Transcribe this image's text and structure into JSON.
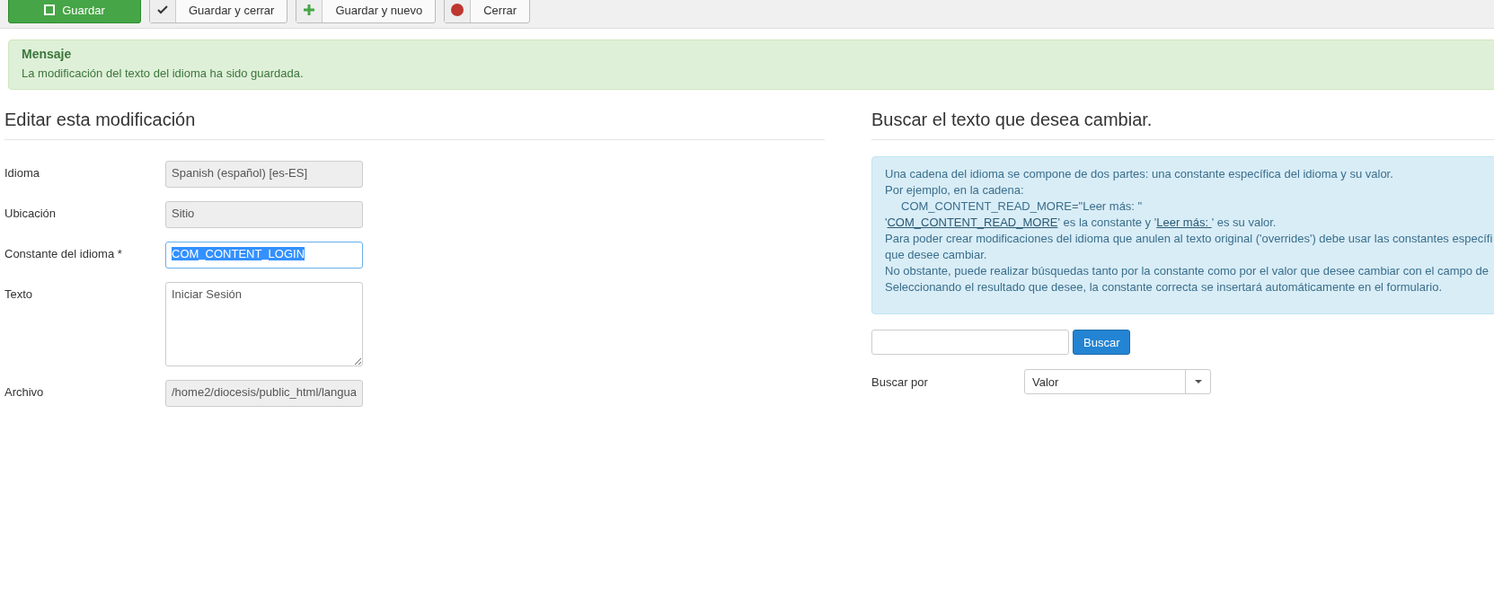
{
  "toolbar": {
    "buttons": [
      {
        "label": "Guardar",
        "kind": "primary"
      },
      {
        "label": "Guardar y cerrar",
        "kind": "default"
      },
      {
        "label": "Guardar y nuevo",
        "kind": "default"
      },
      {
        "label": "Cerrar",
        "kind": "default"
      }
    ]
  },
  "message": {
    "title": "Mensaje",
    "text": "La modificación del texto del idioma ha sido guardada."
  },
  "edit": {
    "heading": "Editar esta modificación",
    "fields": [
      {
        "label": "Idioma",
        "kind": "input",
        "value": "Spanish (español) [es-ES]",
        "readonly": true,
        "focused": false,
        "selected": false
      },
      {
        "label": "Ubicación",
        "kind": "input",
        "value": "Sitio",
        "readonly": true,
        "focused": false,
        "selected": false
      },
      {
        "label": "Constante del idioma *",
        "kind": "input",
        "value": "COM_CONTENT_LOGIN",
        "readonly": false,
        "focused": true,
        "selected": true
      },
      {
        "label": "Texto",
        "kind": "textarea",
        "value": "Iniciar Sesión",
        "readonly": false,
        "focused": false
      },
      {
        "label": "Archivo",
        "kind": "input",
        "value": "/home2/diocesis/public_html/langua",
        "readonly": true,
        "focused": false,
        "selected": false
      }
    ]
  },
  "search": {
    "heading": "Buscar el texto que desea cambiar.",
    "info": [
      {
        "kind": "text",
        "text": "Una cadena del idioma se compone de dos partes: una constante específica del idioma y su valor."
      },
      {
        "kind": "text",
        "text": "Por ejemplo, en la cadena:"
      },
      {
        "kind": "code",
        "text": "COM_CONTENT_READ_MORE=\"Leer más: \""
      },
      {
        "kind": "example",
        "segments": [
          {
            "kind": "text",
            "text": "'"
          },
          {
            "kind": "link",
            "text": "COM_CONTENT_READ_MORE"
          },
          {
            "kind": "text",
            "text": "' es la constante y '"
          },
          {
            "kind": "link",
            "text": "Leer más: "
          },
          {
            "kind": "text",
            "text": "' es su valor."
          }
        ]
      },
      {
        "kind": "text",
        "text": "Para poder crear modificaciones del idioma que anulen al texto original ('overrides') debe usar las constantes específi"
      },
      {
        "kind": "text",
        "text": "que desee cambiar."
      },
      {
        "kind": "text",
        "text": "No obstante, puede realizar búsquedas tanto por la constante como por el valor que desee cambiar con el campo de"
      },
      {
        "kind": "text",
        "text": "Seleccionando el resultado que desee, la constante correcta se insertará automáticamente en el formulario."
      }
    ],
    "button": "Buscar",
    "filter_label": "Buscar por",
    "filter_value": "Valor"
  }
}
